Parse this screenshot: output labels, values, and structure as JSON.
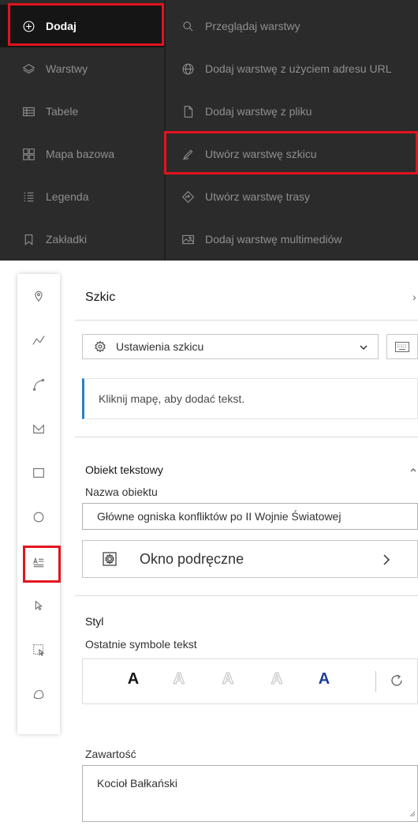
{
  "menu": {
    "left_items": [
      {
        "label": "Dodaj",
        "icon": "plus-circle-icon"
      },
      {
        "label": "Warstwy",
        "icon": "layers-icon"
      },
      {
        "label": "Tabele",
        "icon": "table-icon"
      },
      {
        "label": "Mapa bazowa",
        "icon": "basemap-icon"
      },
      {
        "label": "Legenda",
        "icon": "legend-icon"
      },
      {
        "label": "Zakładki",
        "icon": "bookmark-icon"
      }
    ],
    "right_items": [
      {
        "label": "Przeglądaj warstwy",
        "icon": "search-icon"
      },
      {
        "label": "Dodaj warstwę z użyciem adresu URL",
        "icon": "globe-icon"
      },
      {
        "label": "Dodaj warstwę z pliku",
        "icon": "file-icon"
      },
      {
        "label": "Utwórz warstwę szkicu",
        "icon": "sketch-pen-icon"
      },
      {
        "label": "Utwórz warstwę trasy",
        "icon": "route-icon"
      },
      {
        "label": "Dodaj warstwę multimediów",
        "icon": "media-icon"
      }
    ]
  },
  "tools": [
    "point-tool-icon",
    "polyline-tool-icon",
    "curve-tool-icon",
    "polygon-tool-icon",
    "rectangle-tool-icon",
    "circle-tool-icon",
    "text-tool-icon",
    "select-tool-icon",
    "lasso-select-icon",
    "freehand-tool-icon"
  ],
  "panel": {
    "title": "Szkic",
    "settings_label": "Ustawienia szkicu",
    "notice": "Kliknij mapę, aby dodać tekst.",
    "object_heading": "Obiekt tekstowy",
    "name_label": "Nazwa obiektu",
    "name_value": "Główne ogniska konfliktów po II Wojnie Światowej",
    "popup_label": "Okno podręczne",
    "style_heading": "Styl",
    "recent_label": "Ostatnie symbole tekst",
    "symbols": [
      {
        "letter": "A",
        "color": "#151515",
        "style": "solid"
      },
      {
        "letter": "A",
        "color": "#bdbdbd",
        "style": "outline"
      },
      {
        "letter": "A",
        "color": "#bdbdbd",
        "style": "outline"
      },
      {
        "letter": "A",
        "color": "#bdbdbd",
        "style": "outline"
      },
      {
        "letter": "A",
        "color": "#1c3f94",
        "style": "solid"
      }
    ],
    "content_label": "Zawartość",
    "content_value": "Kocioł Bałkański"
  },
  "colors": {
    "highlight": "#e3131f",
    "menu_bg": "#2b2b2b",
    "notice_accent": "#2a7fc7"
  }
}
